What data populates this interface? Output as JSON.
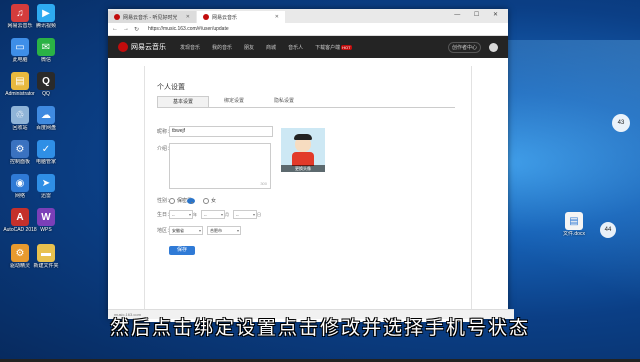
{
  "desktop": {
    "icons": [
      {
        "label": "网易云音乐",
        "glyph": "♫",
        "color": "#d43c3c"
      },
      {
        "label": "腾讯视频",
        "glyph": "▶",
        "color": "#2eaaf0"
      },
      {
        "label": "此电脑",
        "glyph": "▭",
        "color": "#3e8ee8"
      },
      {
        "label": "微信",
        "glyph": "✉",
        "color": "#2bb245"
      },
      {
        "label": "Administrator",
        "glyph": "▤",
        "color": "#e8b93e"
      },
      {
        "label": "QQ",
        "glyph": "Q",
        "color": "#2a2a2a"
      },
      {
        "label": "回收站",
        "glyph": "♲",
        "color": "#8fb4d8"
      },
      {
        "label": "百度网盘",
        "glyph": "☁",
        "color": "#3f8ae0"
      },
      {
        "label": "控制面板",
        "glyph": "⚙",
        "color": "#3a72c0"
      },
      {
        "label": "电脑管家",
        "glyph": "✓",
        "color": "#2f8fe6"
      },
      {
        "label": "网络",
        "glyph": "◉",
        "color": "#2f7ad6"
      },
      {
        "label": "迅雷",
        "glyph": "➤",
        "color": "#2f8fe6"
      },
      {
        "label": "AutoCAD 2018",
        "glyph": "A",
        "color": "#c4302b"
      },
      {
        "label": "WPS",
        "glyph": "W",
        "color": "#7b3fb8"
      },
      {
        "label": "驱动精灵",
        "glyph": "⚙",
        "color": "#e89a2e"
      },
      {
        "label": "新建文件夹",
        "glyph": "▬",
        "color": "#e8c14e"
      }
    ],
    "right_badges": [
      "43",
      "44"
    ],
    "file_label": "文件.docx"
  },
  "browser": {
    "tabs": [
      {
        "title": "网易云音乐 - 听见好时光",
        "active": false
      },
      {
        "title": "网易云音乐",
        "active": true
      }
    ],
    "window_controls": "— ☐ ✕",
    "url": "https://music.163.com/#/user/update"
  },
  "site": {
    "logo": "网易云音乐",
    "nav": [
      "发现音乐",
      "我的音乐",
      "朋友",
      "商城",
      "音乐人",
      "下载客户端"
    ],
    "hot_badge": "HOT",
    "creator_btn": "创作者中心"
  },
  "settings": {
    "title": "个人设置",
    "tabs": [
      "基本设置",
      "绑定设置",
      "隐私设置"
    ],
    "nickname_label": "昵称：",
    "nickname_value": "tbwejf",
    "intro_label": "介绍：",
    "intro_count": "300",
    "avatar_caption": "更换头像",
    "gender_label": "性别：",
    "gender_options": [
      "保密",
      "男",
      "女"
    ],
    "birthday_label": "生日：",
    "birthday": {
      "year": "--",
      "month": "--",
      "day": "--",
      "year_unit": "年",
      "month_unit": "月",
      "day_unit": "日"
    },
    "region_label": "地区：",
    "region": {
      "province": "安徽省",
      "city": "合肥市"
    },
    "save_btn": "保存"
  },
  "statusbar_text": "music.163.com",
  "subtitle": "然后点击绑定设置点击修改并选择手机号状态"
}
